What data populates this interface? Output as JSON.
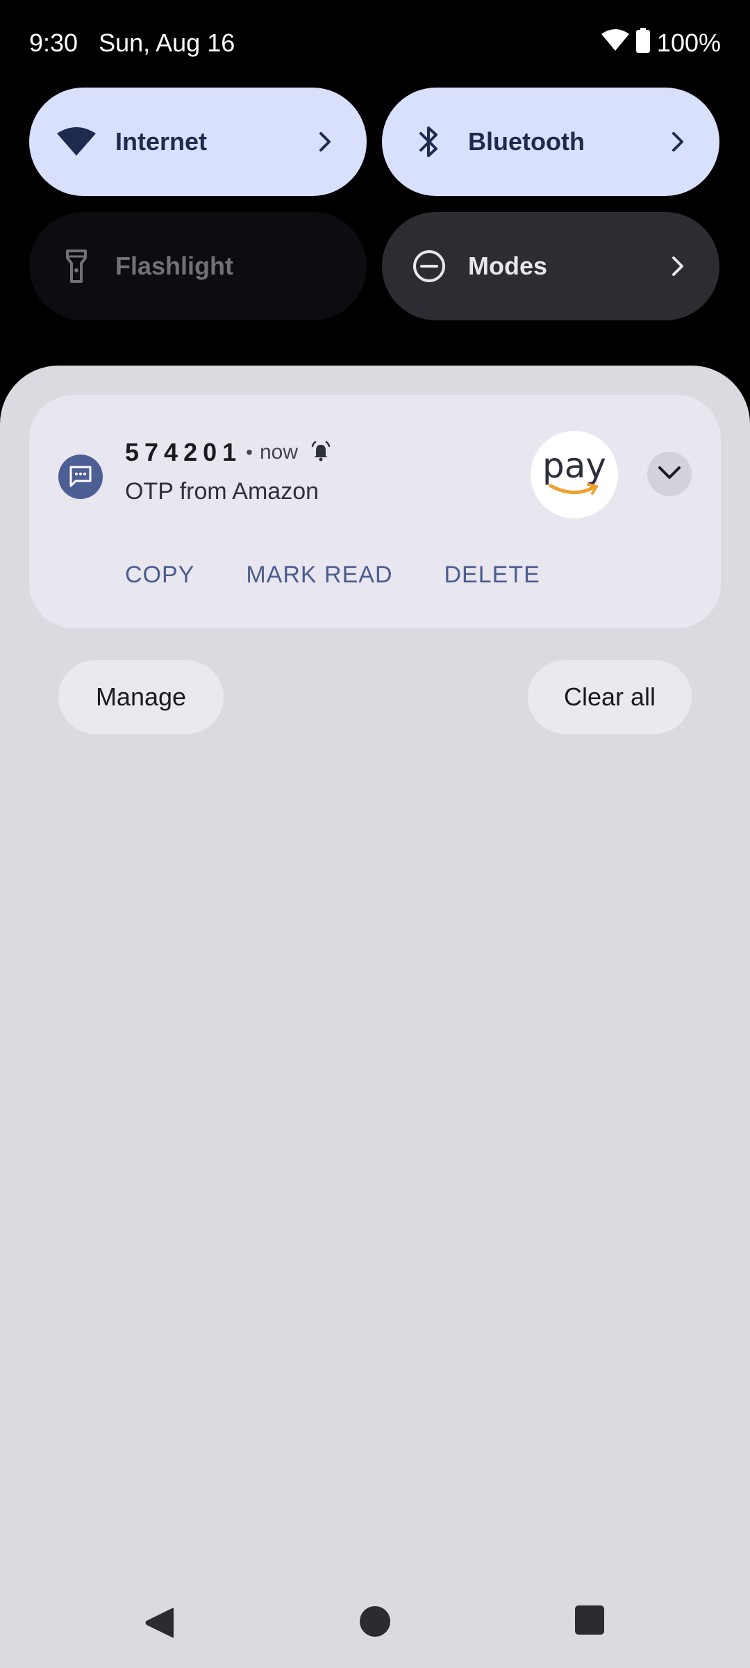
{
  "status_bar": {
    "time": "9:30",
    "date": "Sun, Aug 16",
    "battery": "100%",
    "icons": [
      "wifi-icon",
      "battery-icon"
    ]
  },
  "quick_settings": {
    "tiles": [
      {
        "label": "Internet",
        "icon": "wifi-icon",
        "state": "on",
        "has_chevron": true
      },
      {
        "label": "Bluetooth",
        "icon": "bluetooth-icon",
        "state": "on",
        "has_chevron": true
      },
      {
        "label": "Flashlight",
        "icon": "flashlight-icon",
        "state": "off",
        "has_chevron": false
      },
      {
        "label": "Modes",
        "icon": "do-not-disturb-icon",
        "state": "dark",
        "has_chevron": true
      }
    ]
  },
  "notification": {
    "app_icon": "message-icon",
    "title": "574201",
    "separator": "•",
    "time": "now",
    "alert_icon": "alarm-bell-icon",
    "body": "OTP from Amazon",
    "large_icon_text": "pay",
    "actions": [
      "COPY",
      "MARK READ",
      "DELETE"
    ]
  },
  "shade_footer": {
    "manage_label": "Manage",
    "clear_all_label": "Clear all"
  },
  "navigation": {
    "back": "back-icon",
    "home": "home-icon",
    "recents": "recents-icon"
  },
  "colors": {
    "tile_on": "#d9e0fc",
    "tile_off": "#0c0d11",
    "tile_dark": "#2b2d33",
    "shade_bg": "#dbdae0",
    "card_bg": "#e8e7ef",
    "action_text": "#4c5c8f",
    "amazon_orange": "#f0a02c"
  }
}
